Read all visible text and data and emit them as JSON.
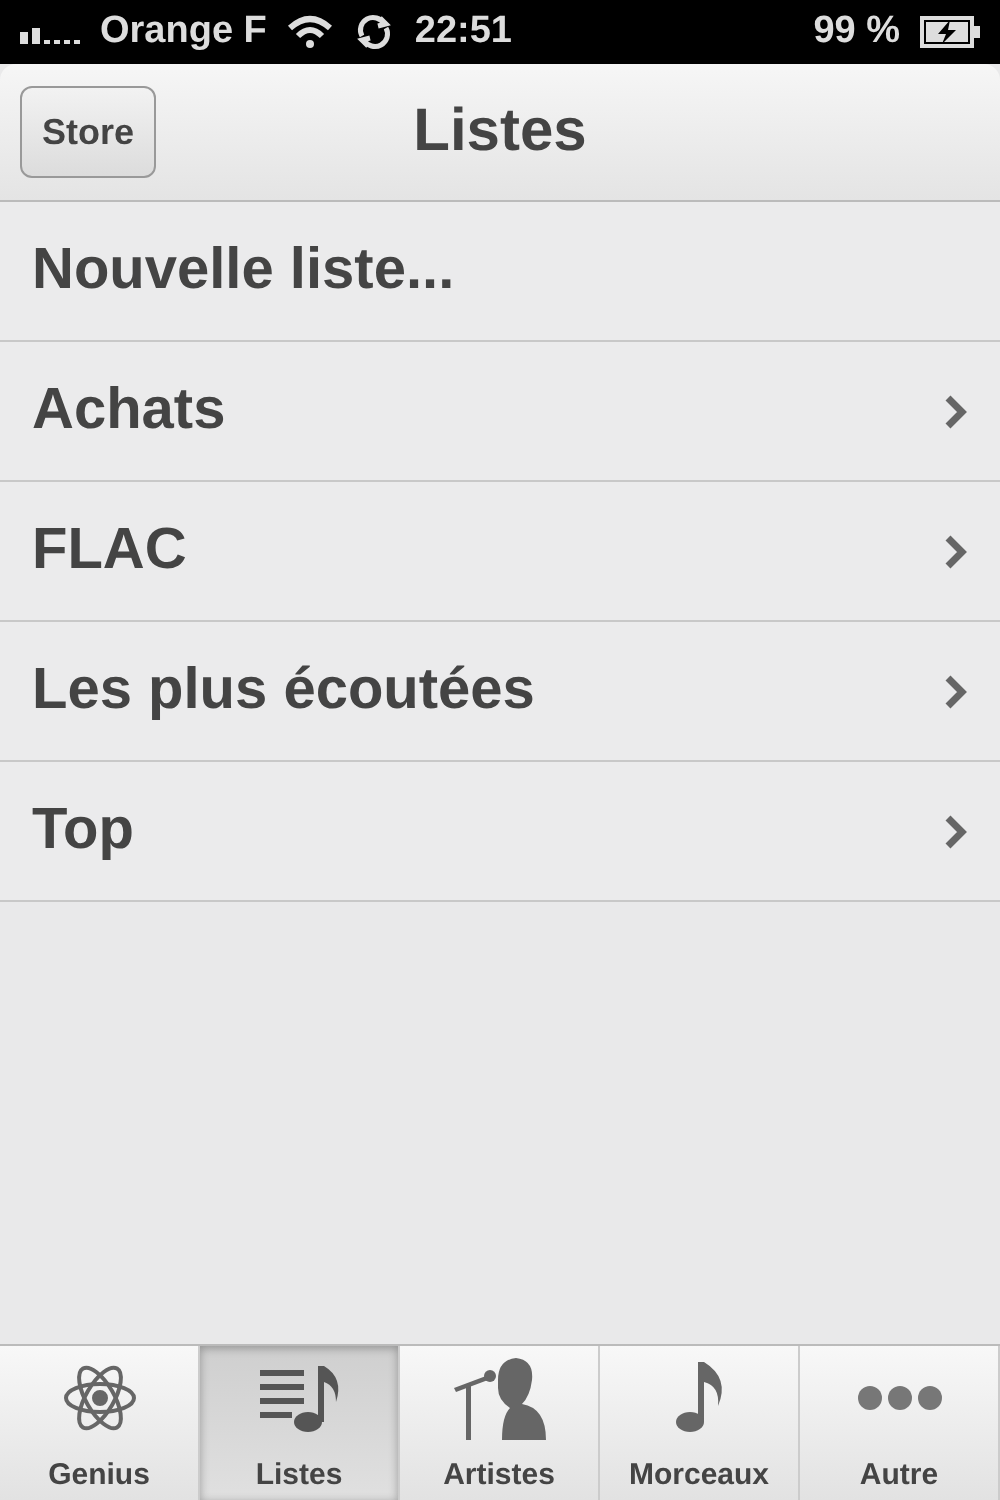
{
  "status_bar": {
    "carrier": "Orange F",
    "time": "22:51",
    "battery": "99 %"
  },
  "nav_bar": {
    "back_button": "Store",
    "title": "Listes"
  },
  "rows": [
    {
      "label": "Nouvelle liste...",
      "kind": "action"
    },
    {
      "label": "Achats",
      "kind": "link"
    },
    {
      "label": "FLAC",
      "kind": "link"
    },
    {
      "label": "Les plus écoutées",
      "kind": "link"
    },
    {
      "label": "Top",
      "kind": "link"
    }
  ],
  "tab_bar": [
    {
      "label": "Genius",
      "selected": false
    },
    {
      "label": "Listes",
      "selected": true
    },
    {
      "label": "Artistes",
      "selected": false
    },
    {
      "label": "Morceaux",
      "selected": false
    },
    {
      "label": "Autre",
      "selected": false
    }
  ]
}
